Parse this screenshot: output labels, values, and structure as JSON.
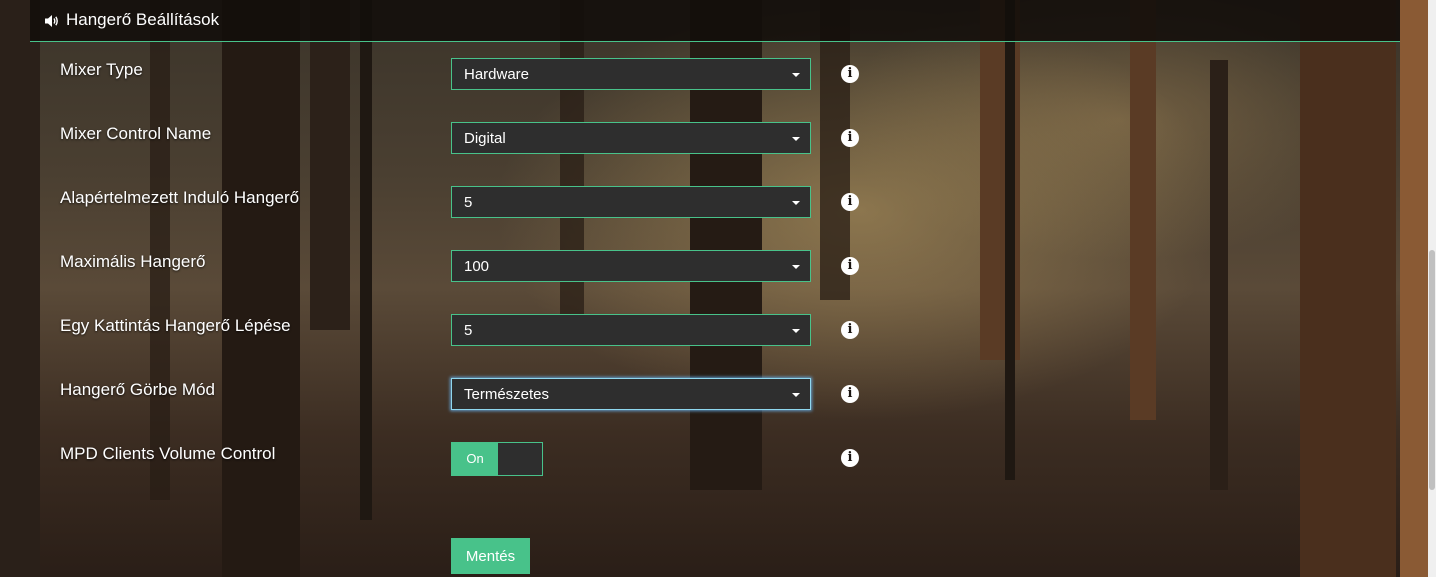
{
  "header": {
    "icon": "volume-up-icon",
    "title": "Hangerő Beállítások"
  },
  "settings": [
    {
      "label": "Mixer Type",
      "value": "Hardware"
    },
    {
      "label": "Mixer Control Name",
      "value": "Digital"
    },
    {
      "label": "Alapértelmezett Induló Hangerő",
      "value": "5"
    },
    {
      "label": "Maximális Hangerő",
      "value": "100"
    },
    {
      "label": "Egy Kattintás Hangerő Lépése",
      "value": "5"
    },
    {
      "label": "Hangerő Görbe Mód",
      "value": "Természetes"
    }
  ],
  "mpd_clients": {
    "label": "MPD Clients Volume Control",
    "toggle_label": "On",
    "enabled": true
  },
  "info_icon": "info-circle-icon",
  "save_label": "Mentés",
  "colors": {
    "accent": "#48c28a",
    "select_bg": "#2e2e2e",
    "focus": "#66afe9"
  }
}
